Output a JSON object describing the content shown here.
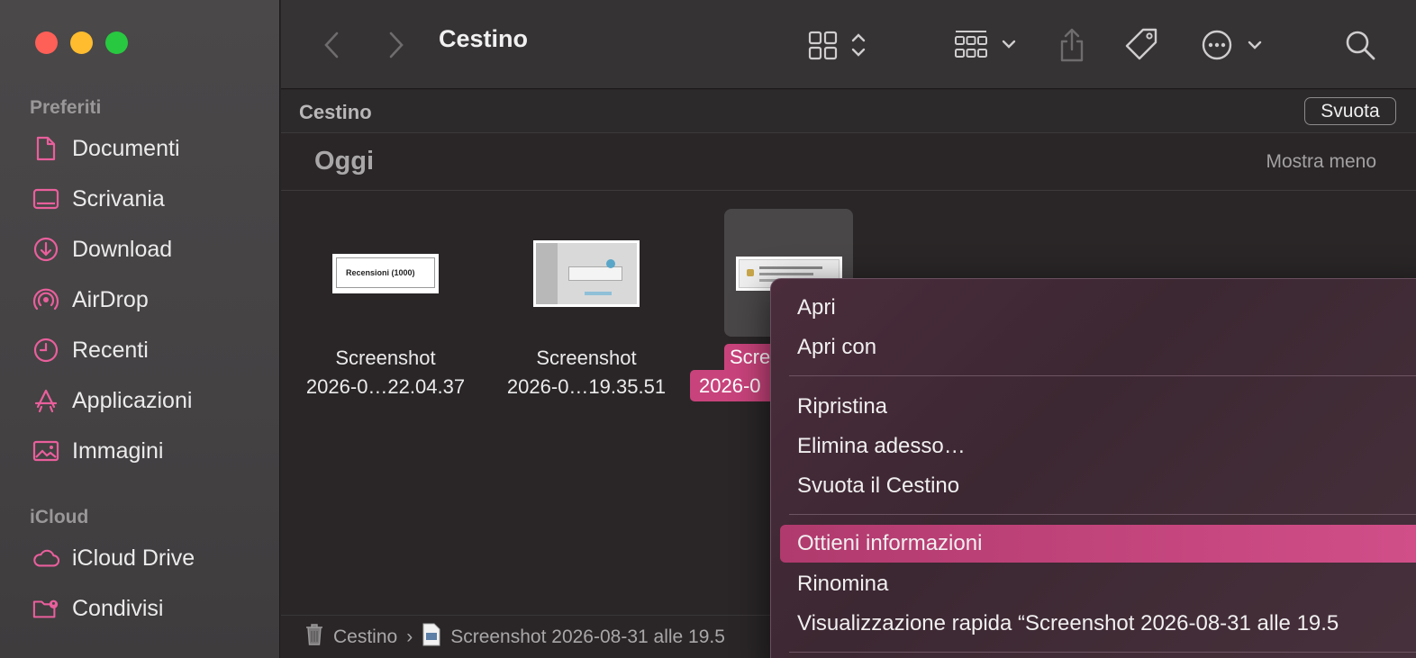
{
  "window": {
    "title": "Cestino"
  },
  "sidebar": {
    "favorites_title": "Preferiti",
    "favorites": [
      {
        "label": "Documenti",
        "icon": "document-icon"
      },
      {
        "label": "Scrivania",
        "icon": "desktop-icon"
      },
      {
        "label": "Download",
        "icon": "download-icon"
      },
      {
        "label": "AirDrop",
        "icon": "airdrop-icon"
      },
      {
        "label": "Recenti",
        "icon": "clock-icon"
      },
      {
        "label": "Applicazioni",
        "icon": "applications-icon"
      },
      {
        "label": "Immagini",
        "icon": "photo-icon"
      }
    ],
    "icloud_title": "iCloud",
    "icloud": [
      {
        "label": "iCloud Drive",
        "icon": "cloud-icon"
      },
      {
        "label": "Condivisi",
        "icon": "shared-folder-icon"
      }
    ],
    "accent_color": "#e95f9c"
  },
  "header": {
    "path_title": "Cestino",
    "empty_button": "Svuota"
  },
  "group": {
    "title": "Oggi",
    "toggle": "Mostra meno"
  },
  "files": [
    {
      "line1": "Screenshot",
      "line2": "2026-0…22.04.37",
      "thumb_text": "Recensioni (1000)"
    },
    {
      "line1": "Screenshot",
      "line2": "2026-0…19.35.51"
    },
    {
      "line1": "Scre",
      "line2": "2026-0",
      "selected": true
    }
  ],
  "statusbar": {
    "root": "Cestino",
    "sep": "›",
    "file": "Screenshot 2026-08-31 alle 19.5"
  },
  "context_menu": {
    "items": [
      {
        "label": "Apri"
      },
      {
        "label": "Apri con"
      },
      {
        "label": "Ripristina"
      },
      {
        "label": "Elimina adesso…"
      },
      {
        "label": "Svuota il Cestino"
      },
      {
        "label": "Ottieni informazioni",
        "highlighted": true
      },
      {
        "label": "Rinomina"
      },
      {
        "label": "Visualizzazione rapida “Screenshot 2026-08-31 alle 19.5"
      }
    ],
    "highlight_color": "#c5467e"
  }
}
